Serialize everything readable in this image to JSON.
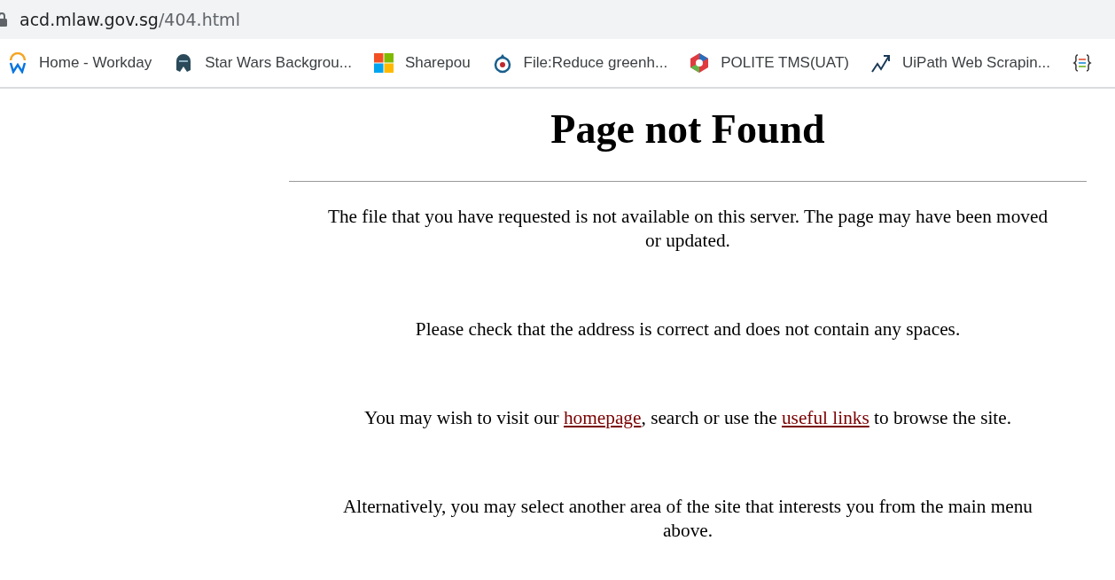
{
  "address_bar": {
    "host": "acd.mlaw.gov.sg",
    "path": "/404.html"
  },
  "bookmarks": [
    {
      "kind": "workday",
      "label": "Home - Workday"
    },
    {
      "kind": "helmet",
      "label": "Star Wars Backgrou..."
    },
    {
      "kind": "squares",
      "label": "Sharepou"
    },
    {
      "kind": "globe",
      "label": "File:Reduce greenh..."
    },
    {
      "kind": "hexagon",
      "label": "POLITE TMS(UAT)"
    },
    {
      "kind": "trend",
      "label": "UiPath Web Scrapin..."
    },
    {
      "kind": "braces"
    }
  ],
  "page": {
    "title": "Page not Found",
    "paragraphs": [
      [
        {
          "text": "The file that you have requested is not available on this server. The page may have been moved or updated.",
          "link": false
        }
      ],
      [
        {
          "text": "Please check that the address is correct and does not contain any spaces.",
          "link": false
        }
      ],
      [
        {
          "text": "You may wish to visit our ",
          "link": false
        },
        {
          "text": "homepage",
          "link": true
        },
        {
          "text": ", search or use the ",
          "link": false
        },
        {
          "text": "useful links",
          "link": true
        },
        {
          "text": " to browse the site.",
          "link": false
        }
      ],
      [
        {
          "text": "Alternatively, you may select another area of the site that interests you from the main menu above.",
          "link": false
        }
      ]
    ]
  }
}
